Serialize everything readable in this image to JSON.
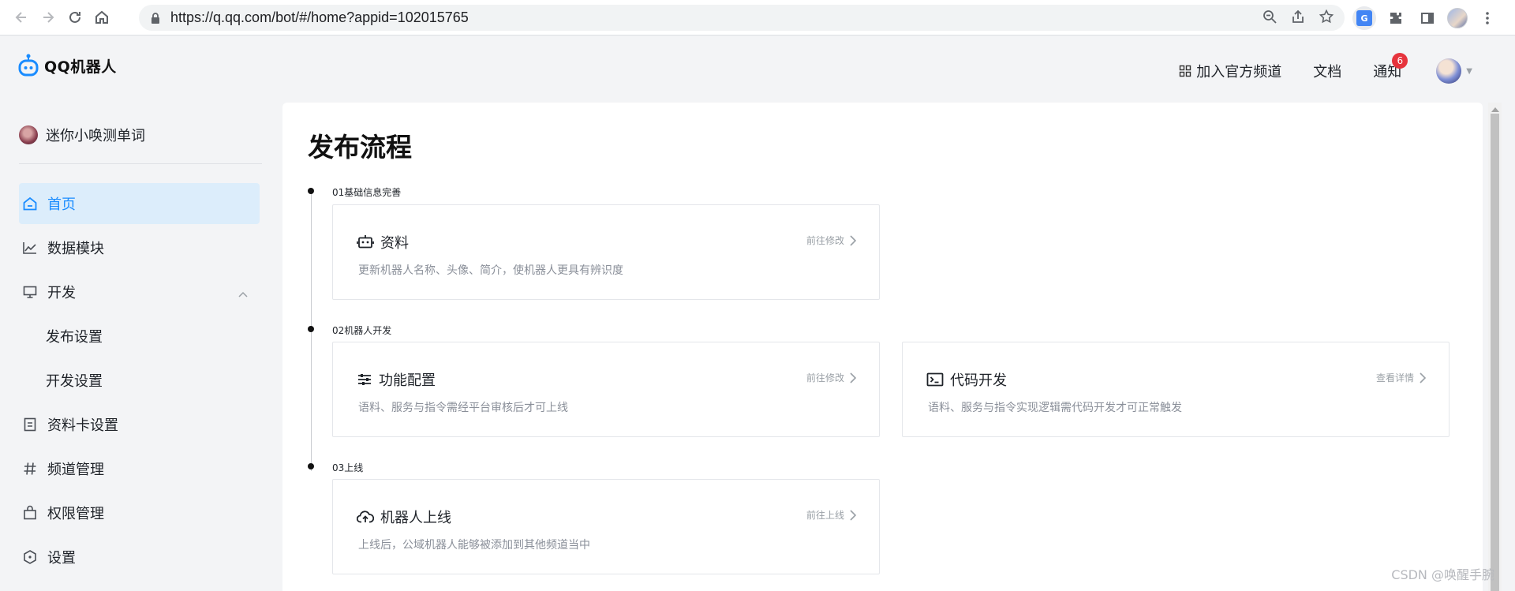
{
  "browser": {
    "url": "https://q.qq.com/bot/#/home?appid=102015765",
    "translate_badge": "G"
  },
  "header": {
    "logo_text": "QQ机器人",
    "join_channel": "加入官方频道",
    "docs": "文档",
    "notifications": "通知",
    "notification_count": "6"
  },
  "sidebar": {
    "bot_name": "迷你小唤测单词",
    "items": [
      {
        "label": "首页",
        "icon": "home-icon",
        "active": true
      },
      {
        "label": "数据模块",
        "icon": "chart-line-icon"
      },
      {
        "label": "开发",
        "icon": "monitor-icon",
        "expandable": true
      },
      {
        "label": "发布设置",
        "sub": true
      },
      {
        "label": "开发设置",
        "sub": true
      },
      {
        "label": "资料卡设置",
        "icon": "card-icon"
      },
      {
        "label": "频道管理",
        "icon": "hash-icon"
      },
      {
        "label": "权限管理",
        "icon": "bag-icon"
      },
      {
        "label": "设置",
        "icon": "hexagon-settings-icon"
      }
    ]
  },
  "main": {
    "title": "发布流程",
    "steps": [
      {
        "label": "01基础信息完善"
      },
      {
        "label": "02机器人开发"
      },
      {
        "label": "03上线"
      }
    ],
    "cards": {
      "profile": {
        "title": "资料",
        "desc": "更新机器人名称、头像、简介，使机器人更具有辨识度",
        "link": "前往修改"
      },
      "feature": {
        "title": "功能配置",
        "desc": "语料、服务与指令需经平台审核后才可上线",
        "link": "前往修改"
      },
      "code": {
        "title": "代码开发",
        "desc": "语料、服务与指令实现逻辑需代码开发才可正常触发",
        "link": "查看详情"
      },
      "launch": {
        "title": "机器人上线",
        "desc": "上线后，公域机器人能够被添加到其他频道当中",
        "link": "前往上线"
      }
    }
  },
  "watermark": "CSDN @唤醒手腕",
  "colors": {
    "accent": "#1a8cff",
    "active_bg": "#dcedfb",
    "badge": "#e6343d"
  }
}
